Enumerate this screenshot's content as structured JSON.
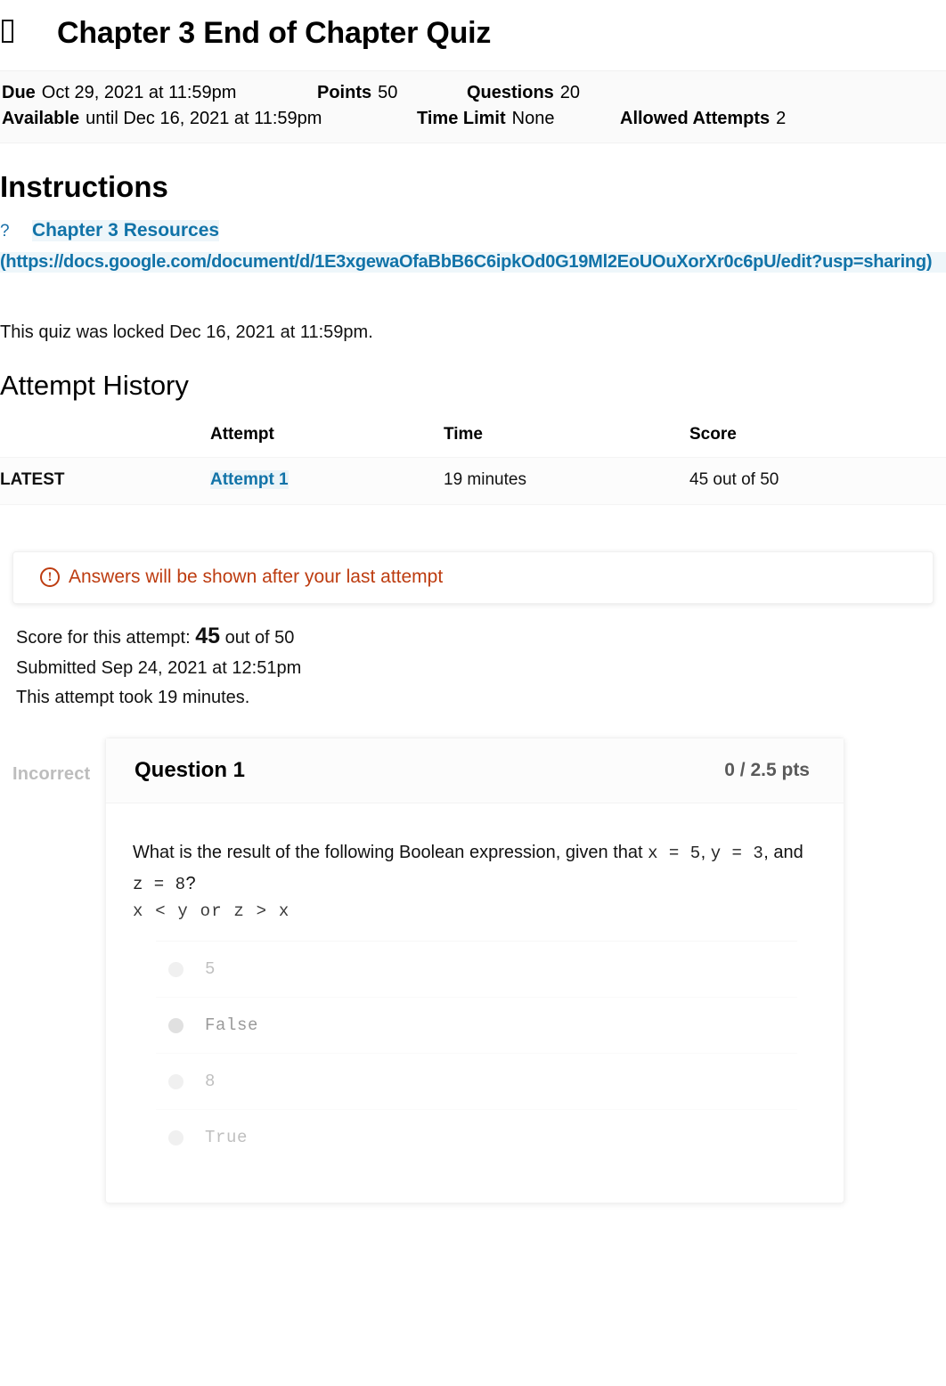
{
  "header": {
    "icon": "quiz-rocket-icon",
    "title": "Chapter 3 End of Chapter Quiz"
  },
  "meta": {
    "due_label": "Due",
    "due_value": "Oct 29, 2021 at 11:59pm",
    "points_label": "Points",
    "points_value": "50",
    "questions_label": "Questions",
    "questions_value": "20",
    "available_label": "Available",
    "available_value": "until Dec 16, 2021 at 11:59pm",
    "time_limit_label": "Time Limit",
    "time_limit_value": "None",
    "allowed_attempts_label": "Allowed Attempts",
    "allowed_attempts_value": "2"
  },
  "instructions": {
    "heading": "Instructions",
    "qmark": "?",
    "link_text": "Chapter 3 Resources",
    "link_url": "(https://docs.google.com/document/d/1E3xgewaOfaBbB6C6ipkOd0G19Ml2EoUOuXorXr0c6pU/edit?usp=sharing)",
    "locked_note": "This quiz was locked Dec 16, 2021 at 11:59pm."
  },
  "attempt_history": {
    "heading": "Attempt History",
    "columns": [
      "",
      "Attempt",
      "Time",
      "Score"
    ],
    "rows": [
      {
        "latest": "LATEST",
        "attempt": "Attempt 1",
        "time": "19 minutes",
        "score": "45 out of 50"
      }
    ]
  },
  "alert": {
    "icon": "exclamation-circle-icon",
    "glyph": "!",
    "text": "Answers will be shown after your last attempt",
    "color": "#bd3c10"
  },
  "score_summary": {
    "score_prefix": "Score for this attempt:",
    "score_value": "45",
    "score_suffix": "out of 50",
    "submitted": "Submitted Sep 24, 2021 at 12:51pm",
    "duration": "This attempt took 19 minutes."
  },
  "question": {
    "status": "Incorrect",
    "name": "Question 1",
    "points": "0 / 2.5 pts",
    "prompt_part1": "What is the result of the following Boolean expression, given that ",
    "prompt_code1": "x = 5",
    "prompt_sep1": ", ",
    "prompt_code2": "y = 3",
    "prompt_sep2": ", and ",
    "prompt_code3": "z = 8",
    "prompt_end": "?",
    "expression": "x < y or z > x",
    "answers": [
      {
        "label": "5",
        "selected": false
      },
      {
        "label": "False",
        "selected": true
      },
      {
        "label": "8",
        "selected": false
      },
      {
        "label": "True",
        "selected": false
      }
    ]
  },
  "colors": {
    "link": "#1173a8",
    "alert": "#bd3c10",
    "status_muted": "#bdbdbd",
    "points": "#5a5a5a"
  }
}
